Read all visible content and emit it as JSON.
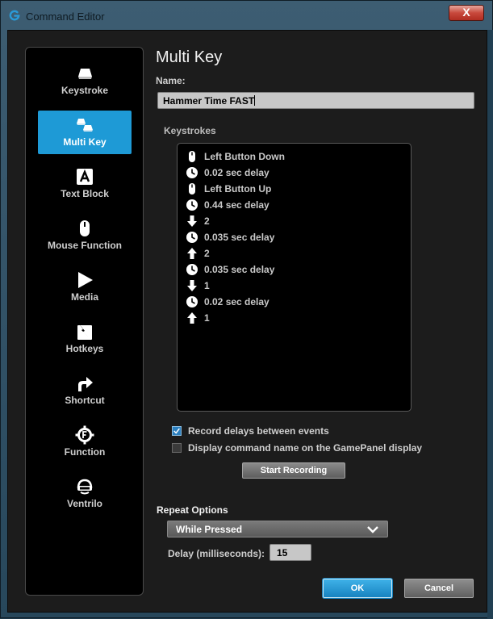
{
  "window": {
    "title": "Command Editor",
    "close_label": "X"
  },
  "sidebar": {
    "items": [
      {
        "label": "Keystroke",
        "icon": "keycap-icon"
      },
      {
        "label": "Multi Key",
        "icon": "multi-keycap-icon"
      },
      {
        "label": "Text Block",
        "icon": "text-a-icon"
      },
      {
        "label": "Mouse Function",
        "icon": "mouse-icon"
      },
      {
        "label": "Media",
        "icon": "play-icon"
      },
      {
        "label": "Hotkeys",
        "icon": "hotkey-icon"
      },
      {
        "label": "Shortcut",
        "icon": "shortcut-arrow-icon"
      },
      {
        "label": "Function",
        "icon": "function-gear-icon"
      },
      {
        "label": "Ventrilo",
        "icon": "headset-icon"
      }
    ],
    "active": "Multi Key"
  },
  "main": {
    "heading": "Multi Key",
    "name_label": "Name:",
    "name_value": "Hammer Time FAST",
    "keystrokes_label": "Keystrokes",
    "keystrokes": [
      {
        "icon": "mouse",
        "text": "Left Button Down"
      },
      {
        "icon": "clock",
        "text": "0.02 sec delay"
      },
      {
        "icon": "mouse",
        "text": "Left Button Up"
      },
      {
        "icon": "clock",
        "text": "0.44 sec delay"
      },
      {
        "icon": "down",
        "text": "2"
      },
      {
        "icon": "clock",
        "text": "0.035 sec delay"
      },
      {
        "icon": "up",
        "text": "2"
      },
      {
        "icon": "clock",
        "text": "0.035 sec delay"
      },
      {
        "icon": "down",
        "text": "1"
      },
      {
        "icon": "clock",
        "text": "0.02 sec delay"
      },
      {
        "icon": "up",
        "text": "1"
      }
    ],
    "record_delays": {
      "label": "Record delays between events",
      "checked": true
    },
    "display_name": {
      "label": "Display command name on the GamePanel display",
      "checked": false
    },
    "start_recording_label": "Start Recording",
    "repeat_options_label": "Repeat Options",
    "repeat_selected": "While Pressed",
    "delay_label": "Delay (milliseconds):",
    "delay_value": "15",
    "ok_label": "OK",
    "cancel_label": "Cancel"
  },
  "colors": {
    "accent": "#1e9ad6",
    "panel": "#000000",
    "window": "#1c1c1c"
  }
}
